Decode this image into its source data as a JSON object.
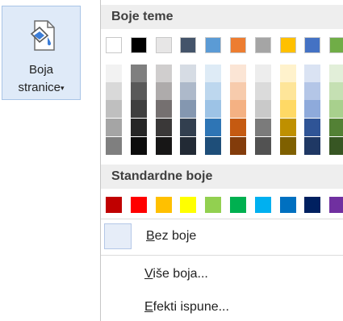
{
  "ribbon_button": {
    "label_line1": "Boja",
    "label_line2": "stranice",
    "caret": "▾",
    "icon": "paint-bucket-icon"
  },
  "menu": {
    "theme_colors_header": "Boje teme",
    "standard_colors_header": "Standardne boje",
    "theme_colors": [
      [
        "#ffffff",
        "#000000",
        "#e7e6e6",
        "#44546a",
        "#5b9bd5",
        "#ed7d31",
        "#a5a5a5",
        "#ffc000",
        "#4472c4",
        "#70ad47"
      ],
      [
        "#f2f2f2",
        "#7f7f7f",
        "#d0cece",
        "#d6dce4",
        "#deebf6",
        "#fbe5d5",
        "#ededed",
        "#fff2cc",
        "#dae3f3",
        "#e2efd9"
      ],
      [
        "#d9d9d9",
        "#595959",
        "#aeabab",
        "#adb9ca",
        "#bdd7ee",
        "#f7cbac",
        "#dbdbdb",
        "#fee599",
        "#b4c6e7",
        "#c5e0b3"
      ],
      [
        "#bfbfbf",
        "#3f3f3f",
        "#757070",
        "#8497b0",
        "#9dc3e6",
        "#f4b183",
        "#c9c9c9",
        "#ffd965",
        "#8eaadb",
        "#a8d08d"
      ],
      [
        "#a5a5a5",
        "#262626",
        "#3a3838",
        "#323f4f",
        "#2e75b5",
        "#c55a11",
        "#7b7b7b",
        "#bf9000",
        "#2f5496",
        "#538135"
      ],
      [
        "#7f7f7f",
        "#0c0c0c",
        "#171616",
        "#222a35",
        "#1e4e79",
        "#833c0b",
        "#525252",
        "#7f6000",
        "#1f3864",
        "#375623"
      ]
    ],
    "standard_colors": [
      "#c00000",
      "#ff0000",
      "#ffc000",
      "#ffff00",
      "#92d050",
      "#00b050",
      "#00b0f0",
      "#0070c0",
      "#002060",
      "#7030a0"
    ],
    "no_color": {
      "underline": "B",
      "rest": "ez boje"
    },
    "more_colors": {
      "underline": "V",
      "rest": "iše boja..."
    },
    "fill_effects": {
      "underline": "E",
      "rest": "fekti ispune..."
    }
  }
}
